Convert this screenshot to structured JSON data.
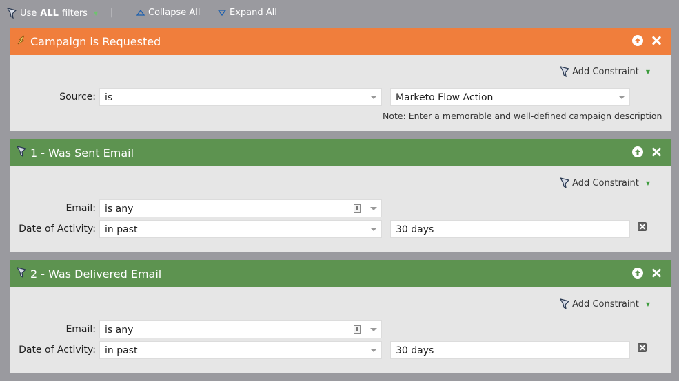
{
  "toolbar": {
    "use_prefix": "Use",
    "use_strong": "ALL",
    "use_suffix": "filters",
    "separator": "|",
    "collapse_all": "Collapse All",
    "expand_all": "Expand All"
  },
  "colors": {
    "trigger_header": "#f07e3c",
    "filter_header": "#5d9350",
    "background": "#9a9a9f",
    "panel_body": "#e6e6e6"
  },
  "add_constraint_label": "Add Constraint",
  "panels": [
    {
      "title": "Campaign is Requested",
      "type": "trigger",
      "icon": "trigger-bolt-icon",
      "rows": [
        {
          "label": "Source:",
          "operator": "is",
          "value": "Marketo Flow Action"
        }
      ],
      "note": "Note: Enter a memorable and well-defined campaign description"
    },
    {
      "title": "1 - Was Sent Email",
      "type": "filter",
      "icon": "filter-funnel-icon",
      "rows": [
        {
          "label": "Email:",
          "operator": "is any"
        },
        {
          "label": "Date of Activity:",
          "operator": "in past",
          "value": "30 days"
        }
      ]
    },
    {
      "title": "2 - Was Delivered Email",
      "type": "filter",
      "icon": "filter-funnel-icon",
      "rows": [
        {
          "label": "Email:",
          "operator": "is any"
        },
        {
          "label": "Date of Activity:",
          "operator": "in past",
          "value": "30 days"
        }
      ]
    }
  ]
}
